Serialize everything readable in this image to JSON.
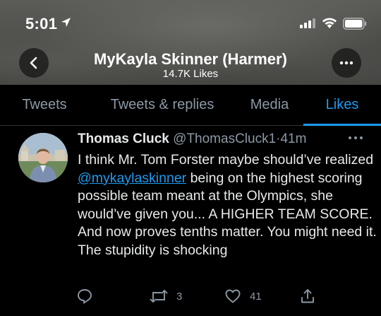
{
  "status_bar": {
    "time": "5:01",
    "icons": [
      "location-arrow-icon",
      "cellular-signal-icon",
      "wifi-icon",
      "battery-icon"
    ]
  },
  "header": {
    "name": "MyKayla Skinner (Harmer)",
    "likes": "14.7K Likes",
    "back_icon": "chevron-left-icon",
    "more_icon": "more-horizontal-icon"
  },
  "tabs": [
    {
      "label": "Tweets",
      "active": false
    },
    {
      "label": "Tweets & replies",
      "active": false
    },
    {
      "label": "Media",
      "active": false
    },
    {
      "label": "Likes",
      "active": true
    }
  ],
  "tweet": {
    "author_name": "Thomas Cluck",
    "handle": "@ThomasCluck1",
    "separator": "·",
    "time": "41m",
    "text_before": "I think Mr. Tom Forster maybe should’ve realized ",
    "mention": "@mykaylaskinner",
    "text_after": " being on the highest scoring possible team meant at the Olympics, she would’ve given you... A HIGHER TEAM SCORE. And now proves tenths matter. You might need it. The stupidity is shocking",
    "retweets": "3",
    "likes": "41",
    "icons": [
      "reply-icon",
      "retweet-icon",
      "heart-icon",
      "share-icon"
    ]
  },
  "colors": {
    "accent": "#1d9bf0",
    "background": "#000000",
    "muted_text": "#8b98a5",
    "primary_text": "#e7e9ea"
  }
}
